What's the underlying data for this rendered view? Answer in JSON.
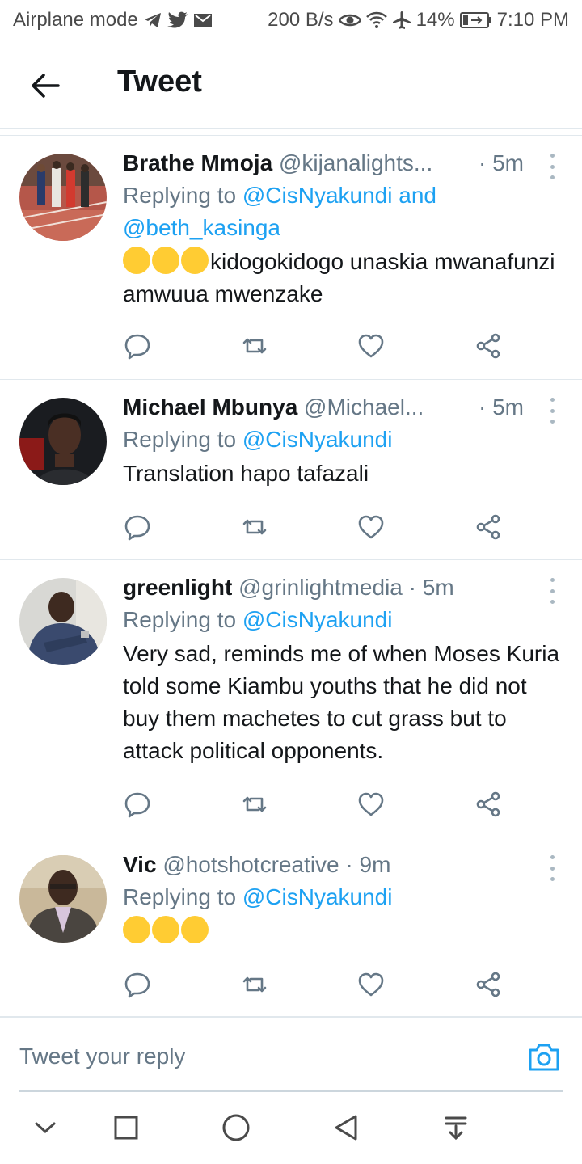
{
  "status_bar": {
    "left_text": "Airplane mode",
    "icons_left": [
      "telegram-icon",
      "twitter-icon",
      "mail-icon"
    ],
    "speed": "200 B/s",
    "icons_right": [
      "eye-icon",
      "wifi-icon",
      "airplane-icon"
    ],
    "battery": "14%",
    "time": "7:10 PM"
  },
  "header": {
    "title": "Tweet",
    "back_icon": "back-arrow-icon"
  },
  "tweets": [
    {
      "name": "Brathe Mmoja",
      "handle": "@kijanalights...",
      "time": "· 5m",
      "reply_prefix": "Replying to",
      "mentions": "@CisNyakundi and @beth_kasinga",
      "text": "kidogokidogo unaskia mwanafunzi amwuua mwenzake",
      "emoji": [
        "loudly-crying-face",
        "loudly-crying-face",
        "loudly-crying-face"
      ]
    },
    {
      "name": "Michael Mbunya",
      "handle": "@Michael...",
      "time": "· 5m",
      "reply_prefix": "Replying to",
      "mentions": "@CisNyakundi",
      "text": "Translation hapo tafazali"
    },
    {
      "name": "greenlight",
      "handle": "@grinlightmedia",
      "time": "· 5m",
      "reply_prefix": "Replying to",
      "mentions": "@CisNyakundi",
      "text": "Very sad, reminds me of when Moses Kuria told some Kiambu youths that he did not buy them machetes to cut grass but to attack political opponents."
    },
    {
      "name": "Vic",
      "handle": "@hotshotcreative",
      "time": "· 9m",
      "reply_prefix": "Replying to",
      "mentions": "@CisNyakundi",
      "text": "",
      "emoji": [
        "flushed-face",
        "flushed-face",
        "flushed-face"
      ]
    }
  ],
  "reply_bar": {
    "placeholder": "Tweet your reply",
    "camera_icon": "camera-icon"
  },
  "colors": {
    "accent": "#1da1f2",
    "text": "#14171a",
    "muted": "#657786",
    "divider": "#e1e8ed"
  }
}
